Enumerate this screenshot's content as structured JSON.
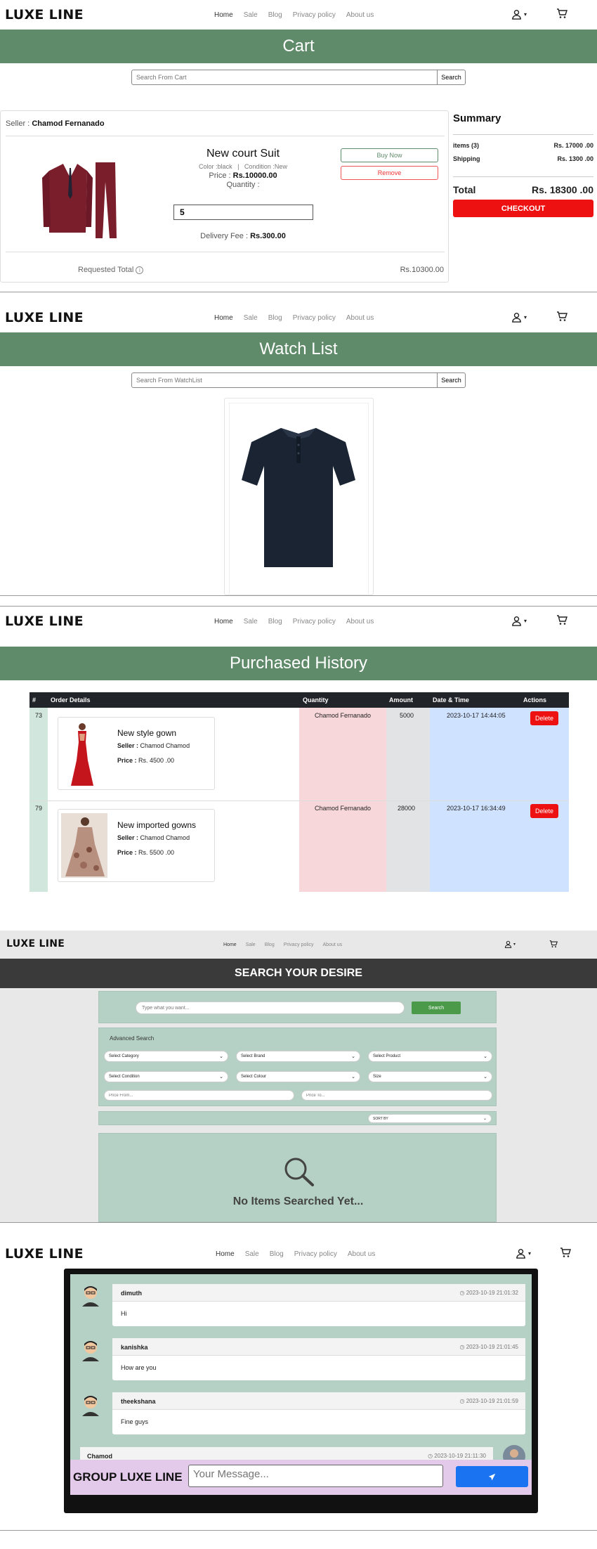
{
  "nav": {
    "logo": "LUXE LINE",
    "links": [
      "Home",
      "Sale",
      "Blog",
      "Privacy policy",
      "About us"
    ],
    "user_caret": "▾"
  },
  "cart": {
    "banner": "Cart",
    "search_placeholder": "Search From Cart",
    "search_button": "Search",
    "seller_label": "Seller :",
    "seller_name": "Chamod Fernanado",
    "product": {
      "title": "New court Suit",
      "meta": "Color :black   |   Condition :New",
      "price_label": "Price :",
      "price": "Rs.10000.00",
      "quantity_label": "Quantity :",
      "quantity": "5",
      "delivery_label": "Delivery Fee :",
      "delivery": "Rs.300.00",
      "buy_now": "Buy Now",
      "remove": "Remove"
    },
    "requested_total_label": "Requested Total",
    "requested_total": "Rs.10300.00",
    "summary": {
      "title": "Summary",
      "items_label": "items (3)",
      "items_value": "Rs. 17000 .00",
      "shipping_label": "Shipping",
      "shipping_value": "Rs. 1300 .00",
      "total_label": "Total",
      "total_value": "Rs. 18300 .00",
      "checkout": "CHECKOUT"
    }
  },
  "watch": {
    "banner": "Watch List",
    "search_placeholder": "Search From WatchList",
    "search_button": "Search"
  },
  "history": {
    "banner": "Purchased History",
    "headers": [
      "#",
      "Order Details",
      "Quantity",
      "Amount",
      "Date & Time",
      "Actions"
    ],
    "rows": [
      {
        "id": "73",
        "title": "New style gown",
        "seller_label": "Seller :",
        "seller": "Chamod Chamod",
        "price_label": "Price :",
        "price": "Rs. 4500 .00",
        "quantity": "Chamod Fernanado",
        "amount": "5000",
        "date": "2023-10-17 14:44:05",
        "action": "Delete"
      },
      {
        "id": "79",
        "title": "New imported gowns",
        "seller_label": "Seller :",
        "seller": "Chamod Chamod",
        "price_label": "Price :",
        "price": "Rs. 5500 .00",
        "quantity": "Chamod Fernanado",
        "amount": "28000",
        "date": "2023-10-17 16:34:49",
        "action": "Delete"
      }
    ]
  },
  "search": {
    "banner": "SEARCH YOUR DESIRE",
    "placeholder": "Type what you want...",
    "button": "Search",
    "advanced_title": "Advanced Search",
    "selects": [
      "Select Category",
      "Select Brand",
      "Select Product",
      "Select Condition",
      "Select Colour",
      "Size"
    ],
    "price_from": "Price From...",
    "price_to": "Price To...",
    "sort": "SORT BY",
    "empty": "No Items Searched Yet..."
  },
  "chat": {
    "messages": [
      {
        "name": "dimuth",
        "time": "2023-10-19 21:01:32",
        "text": "Hi"
      },
      {
        "name": "kanishka",
        "time": "2023-10-19 21:01:45",
        "text": "How are you"
      },
      {
        "name": "theekshana",
        "time": "2023-10-19 21:01:59",
        "text": "Fine guys"
      }
    ],
    "own": {
      "name": "Chamod",
      "time": "2023-10-19 21:11:30"
    },
    "group_title": "GROUP LUXE LINE",
    "input_placeholder": "Your Message...",
    "send_icon": "paper-plane-icon"
  },
  "colors": {
    "banner_green": "#5f8b6a",
    "search_banner": "#3a3a3a",
    "mint_panel": "#b5d1c6",
    "delete_red": "#ee1111",
    "send_blue": "#1a73f0",
    "chat_footer": "#e3c9ea"
  }
}
